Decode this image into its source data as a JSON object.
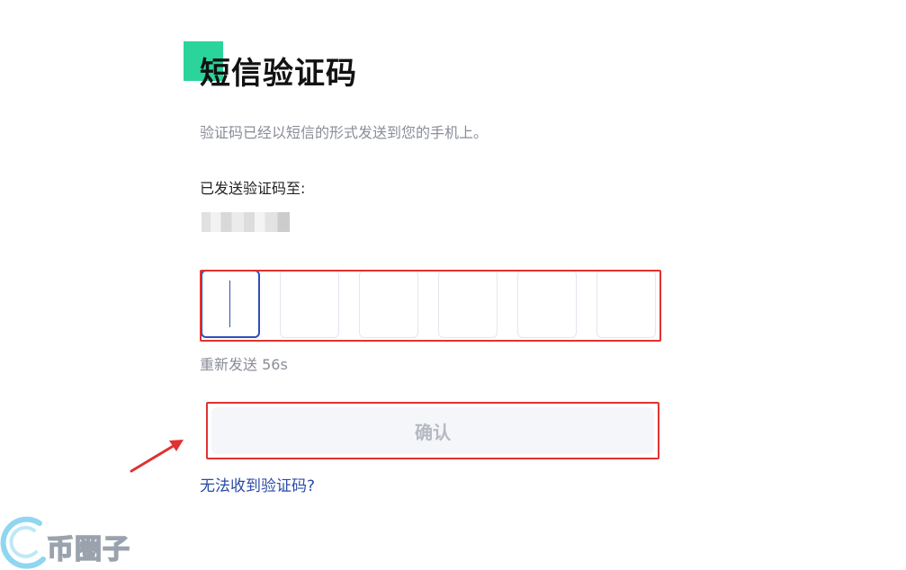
{
  "header": {
    "title": "短信验证码",
    "subtitle": "验证码已经以短信的形式发送到您的手机上。"
  },
  "recipient": {
    "label": "已发送验证码至:"
  },
  "code_input": {
    "digits": [
      "",
      "",
      "",
      "",
      "",
      ""
    ],
    "active_index": 0
  },
  "resend": {
    "label": "重新发送 56s"
  },
  "confirm": {
    "label": "确认"
  },
  "help": {
    "link_label": "无法收到验证码?"
  },
  "watermark": {
    "text": "币圈子"
  },
  "colors": {
    "accent": "#2bd49a",
    "highlight": "#e03232",
    "link": "#2a4aa8",
    "active_box": "#2f4fb8"
  }
}
